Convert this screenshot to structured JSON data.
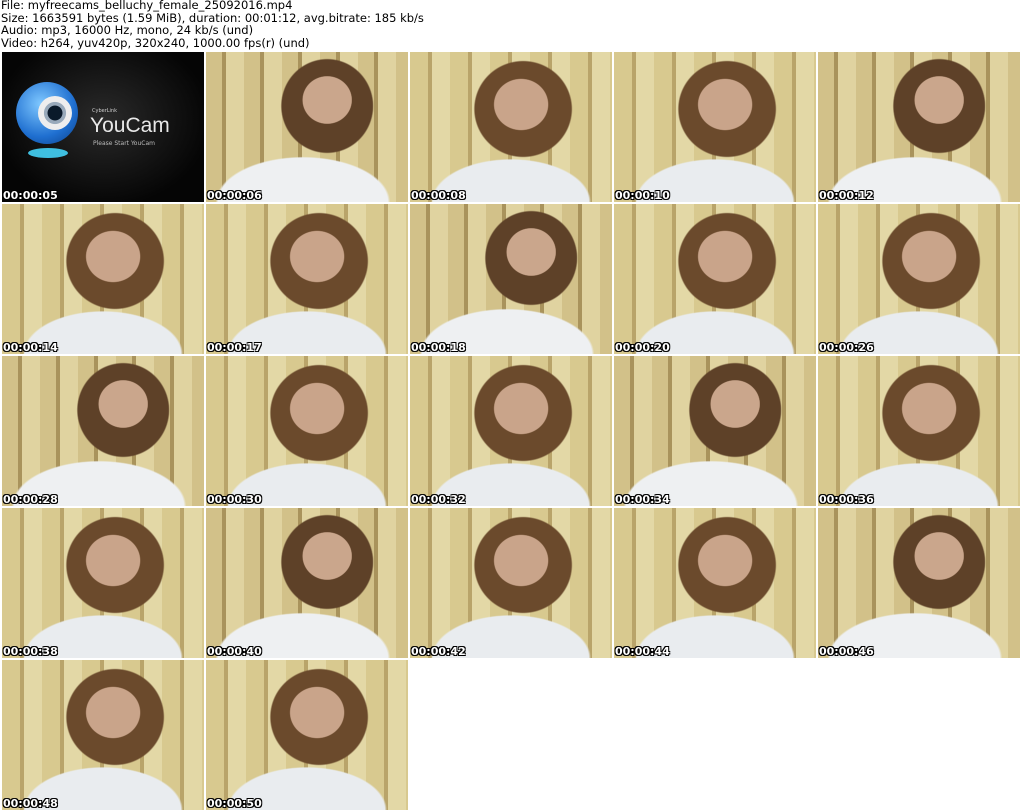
{
  "info": {
    "file": "File: myfreecams_belluchy_female_25092016.mp4",
    "size": "Size: 1663591 bytes (1.59 MiB), duration: 00:01:12, avg.bitrate: 185 kb/s",
    "audio": "Audio: mp3, 16000 Hz, mono, 24 kb/s (und)",
    "video": "Video: h264, yuv420p, 320x240, 1000.00 fps(r) (und)"
  },
  "logo": {
    "small": "CyberLink",
    "name": "YouCam",
    "sub": "Please Start YouCam"
  },
  "thumbnails": [
    "00:00:05",
    "00:00:06",
    "00:00:08",
    "00:00:10",
    "00:00:12",
    "00:00:14",
    "00:00:17",
    "00:00:18",
    "00:00:20",
    "00:00:26",
    "00:00:28",
    "00:00:30",
    "00:00:32",
    "00:00:34",
    "00:00:36",
    "00:00:38",
    "00:00:40",
    "00:00:42",
    "00:00:44",
    "00:00:46",
    "00:00:48",
    "00:00:50"
  ]
}
